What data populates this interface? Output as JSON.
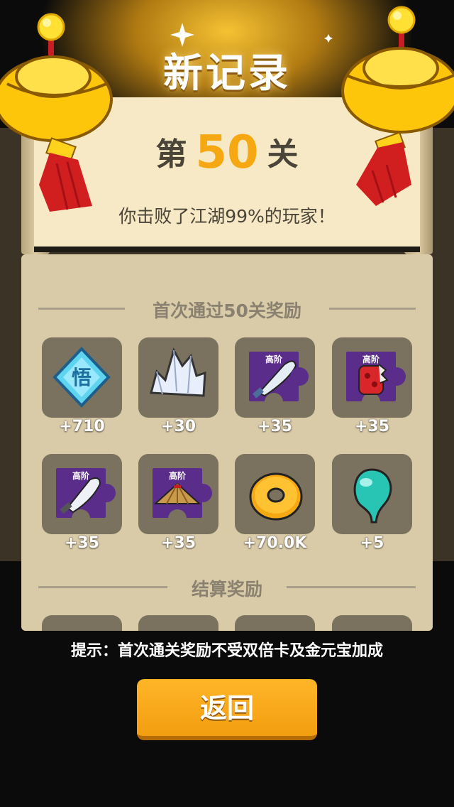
{
  "header": {
    "title": "新记录"
  },
  "record": {
    "prefix": "第",
    "level": "50",
    "suffix": "关",
    "subtitle": "你击败了江湖99%的玩家！"
  },
  "first_clear": {
    "title": "首次通过50关奖励",
    "items": [
      {
        "icon": "wu-enlightenment-icon",
        "label": "+710"
      },
      {
        "icon": "crystal-cluster-icon",
        "label": "+30"
      },
      {
        "icon": "advanced-saber-fragment-icon",
        "grade": "高阶",
        "label": "+35"
      },
      {
        "icon": "advanced-gauntlet-fragment-icon",
        "grade": "高阶",
        "label": "+35"
      },
      {
        "icon": "advanced-blade-fragment-icon",
        "grade": "高阶",
        "label": "+35"
      },
      {
        "icon": "advanced-straw-hat-fragment-icon",
        "grade": "高阶",
        "label": "+35"
      },
      {
        "icon": "gold-coin-ring-icon",
        "label": "+70.0K"
      },
      {
        "icon": "jade-bead-icon",
        "label": "+5"
      }
    ]
  },
  "settlement": {
    "title": "结算奖励"
  },
  "tip": "提示：首次通关奖励不受双倍卡及金元宝加成",
  "back_button": "返回",
  "colors": {
    "accent": "#f5a811",
    "panel": "#d9cba8",
    "slot": "#7a725e",
    "fragment": "#5b2d8a"
  }
}
